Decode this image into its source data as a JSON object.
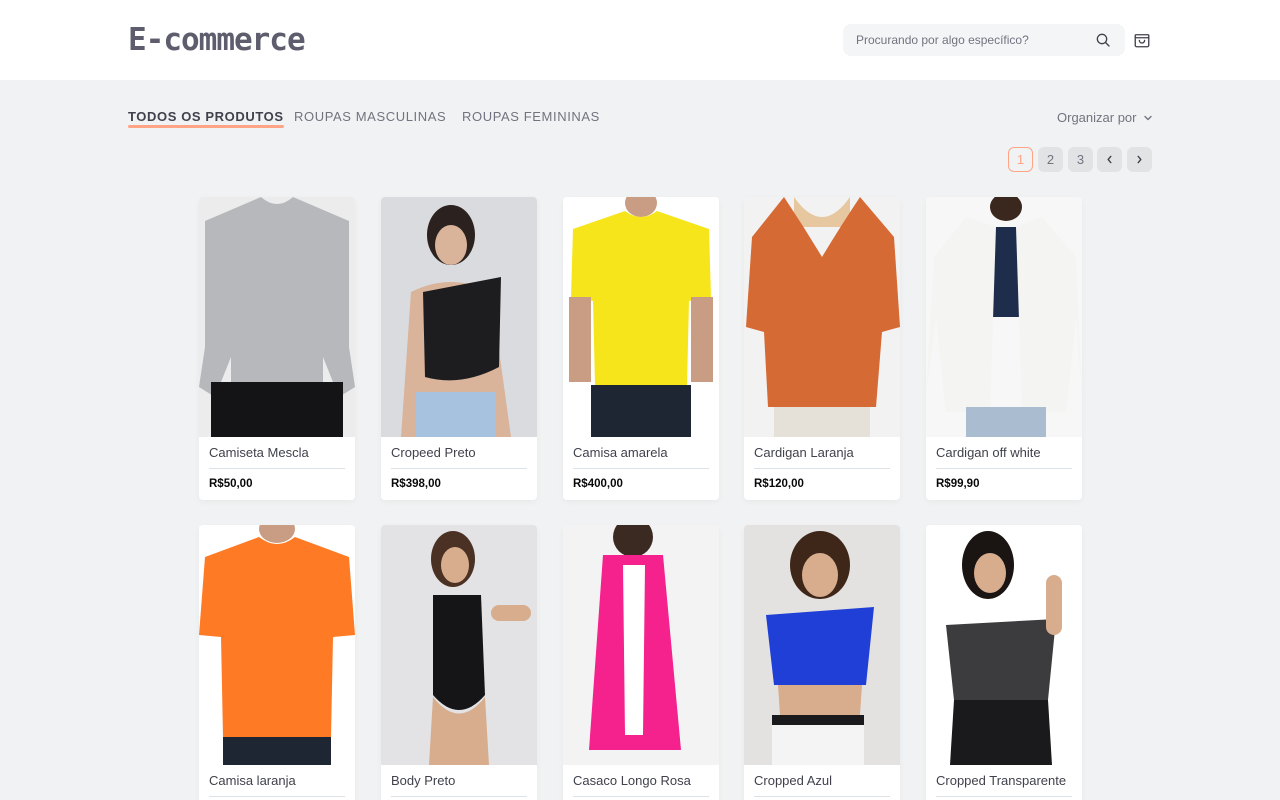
{
  "header": {
    "logo": "E-commerce",
    "search_placeholder": "Procurando por algo específico?"
  },
  "tabs": [
    {
      "label": "Todos os produtos",
      "active": true
    },
    {
      "label": "Roupas masculinas",
      "active": false
    },
    {
      "label": "Roupas femininas",
      "active": false
    }
  ],
  "sort": {
    "label": "Organizar por"
  },
  "pagination": {
    "pages": [
      "1",
      "2",
      "3"
    ],
    "current": "1"
  },
  "products": [
    {
      "name": "Camiseta Mescla",
      "price": "R$50,00",
      "color": "#b7b8bc"
    },
    {
      "name": "Cropeed Preto",
      "price": "R$398,00",
      "color": "#1d1d1f"
    },
    {
      "name": "Camisa amarela",
      "price": "R$400,00",
      "color": "#f6e51b"
    },
    {
      "name": "Cardigan Laranja",
      "price": "R$120,00",
      "color": "#d56a34"
    },
    {
      "name": "Cardigan off white",
      "price": "R$99,90",
      "color": "#f4f4f2"
    },
    {
      "name": "Camisa laranja",
      "price": "",
      "color": "#ff7a24"
    },
    {
      "name": "Body Preto",
      "price": "",
      "color": "#151517"
    },
    {
      "name": "Casaco Longo Rosa",
      "price": "",
      "color": "#f5218c"
    },
    {
      "name": "Cropped Azul",
      "price": "",
      "color": "#1f3fd6"
    },
    {
      "name": "Cropped Transparente",
      "price": "",
      "color": "#1a1a1c"
    }
  ],
  "colors": {
    "accent": "#ffa585",
    "text": "#41414d",
    "muted": "#737380"
  }
}
